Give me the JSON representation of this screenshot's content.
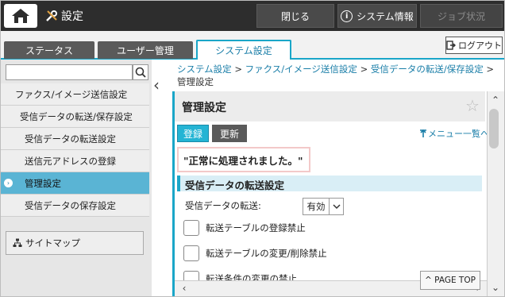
{
  "header": {
    "settings_label": "設定",
    "close_label": "閉じる",
    "system_info_label": "システム情報",
    "job_status_label": "ジョブ状況"
  },
  "tabs": [
    {
      "label": "ステータス"
    },
    {
      "label": "ユーザー管理"
    },
    {
      "label": "システム設定"
    }
  ],
  "logout_label": "ログアウト",
  "sidebar": {
    "items": [
      {
        "label": "ファクス/イメージ送信設定"
      },
      {
        "label": "受信データの転送/保存設定"
      },
      {
        "label": "受信データの転送設定"
      },
      {
        "label": "送信元アドレスの登録"
      },
      {
        "label": "管理設定"
      },
      {
        "label": "受信データの保存設定"
      }
    ],
    "sitemap_label": "サイトマップ"
  },
  "breadcrumb": {
    "links": [
      "システム設定",
      "ファクス/イメージ送信設定",
      "受信データの転送/保存設定"
    ],
    "separator": ">",
    "current": "管理設定"
  },
  "panel": {
    "title": "管理設定",
    "register_label": "登録",
    "update_label": "更新",
    "menu_list_label": "メニュー一覧へ",
    "message": "\"正常に処理されました。\"",
    "section_title": "受信データの転送設定",
    "field_label": "受信データの転送:",
    "field_value": "有効",
    "checkboxes": [
      {
        "label": "転送テーブルの登録禁止",
        "checked": false
      },
      {
        "label": "転送テーブルの変更/削除禁止",
        "checked": false
      },
      {
        "label": "転送条件の変更の禁止",
        "checked": false
      }
    ],
    "page_top_label": "^ PAGE TOP"
  },
  "colors": {
    "accent": "#1aa6c8",
    "topbar": "#2d2d2d",
    "active_item": "#5ab4d4"
  }
}
